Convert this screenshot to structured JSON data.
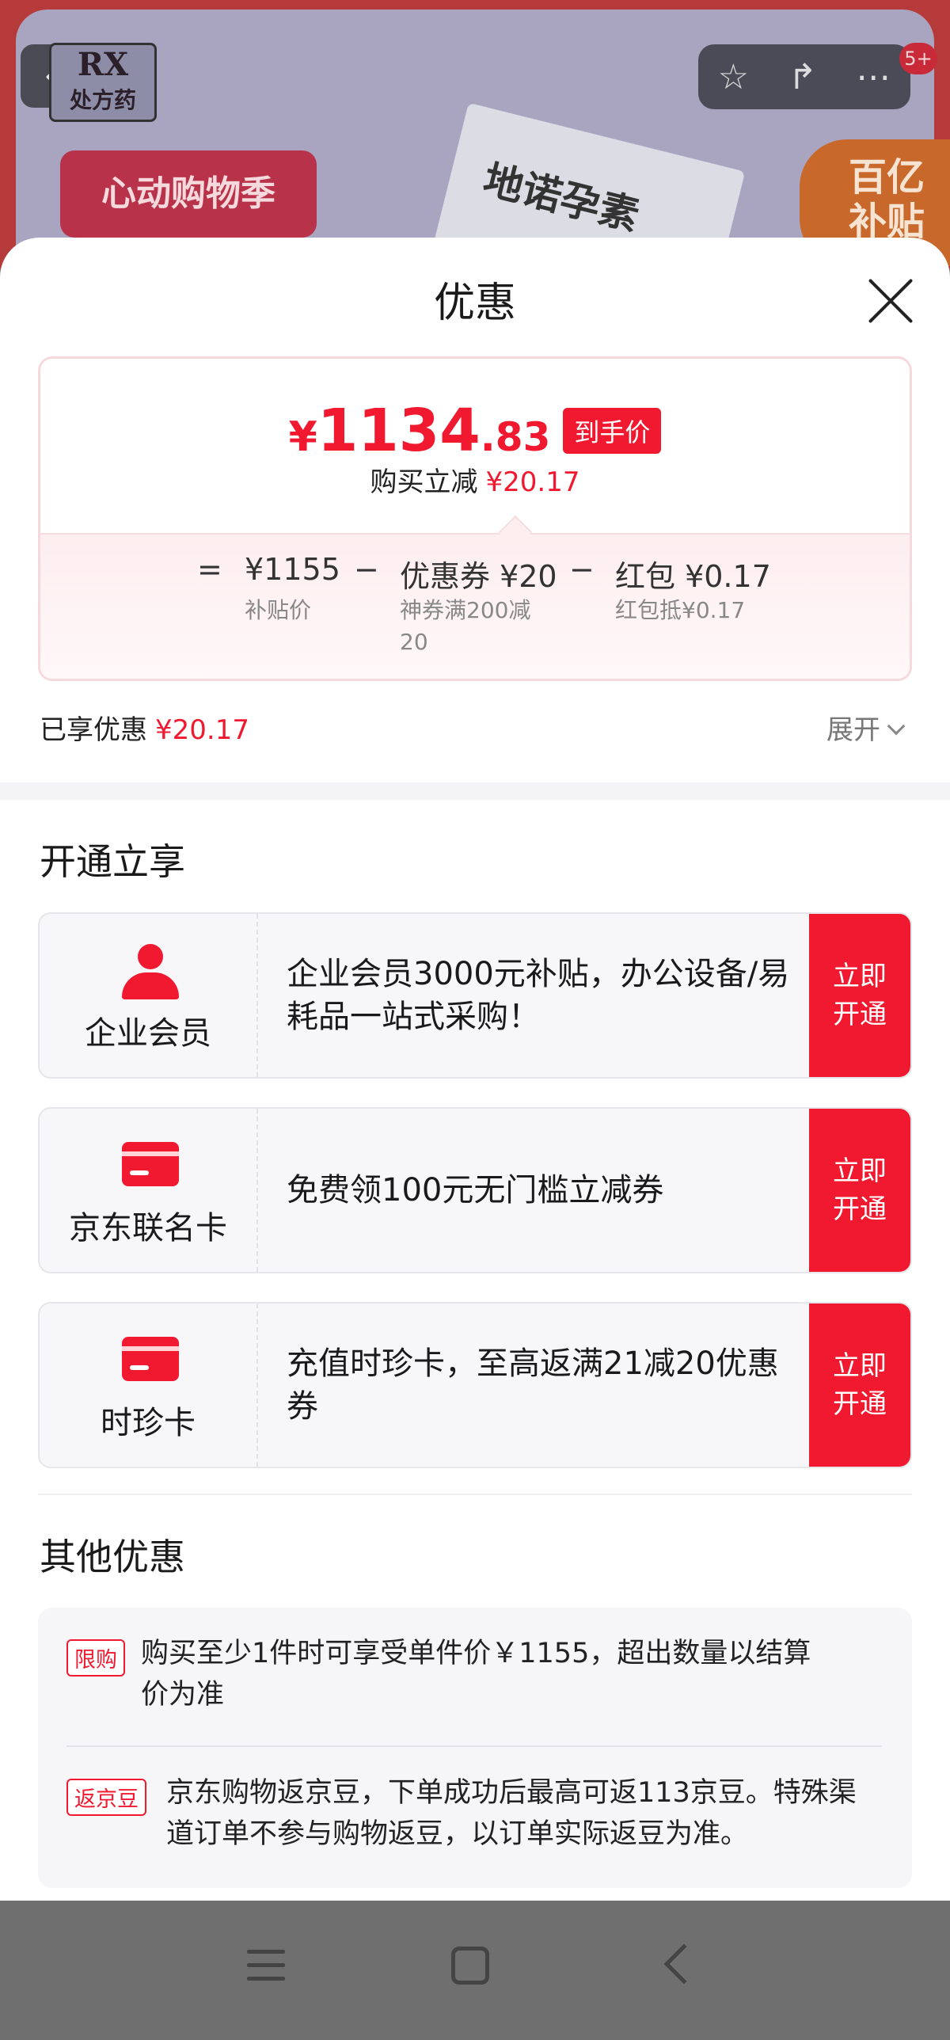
{
  "background": {
    "rx_label": "RX",
    "rx_sub": "处方药",
    "banner": "心动购物季",
    "product_text": "地诺孕素",
    "subsidy": [
      "百亿",
      "补贴"
    ],
    "badge": "5+"
  },
  "sheet": {
    "title": "优惠"
  },
  "price_card": {
    "currency": "¥",
    "price_int": "1134",
    "price_dec": ".83",
    "price_tag": "到手价",
    "sub_label": "购买立减",
    "sub_amount": "¥20.17",
    "formula": {
      "equals": "=",
      "base_value": "¥1155",
      "base_label": "补贴价",
      "minus1": "−",
      "coupon_value": "优惠券 ¥20",
      "coupon_label_line1": "神券满200减",
      "coupon_label_line2": "20",
      "minus2": "−",
      "redpacket_value": "红包 ¥0.17",
      "redpacket_label": "红包抵¥0.17"
    }
  },
  "enjoyed": {
    "label": "已享优惠",
    "amount": "¥20.17",
    "expand": "展开"
  },
  "open_section": {
    "title": "开通立享",
    "cards": [
      {
        "name": "企业会员",
        "icon": "person-icon",
        "desc": "企业会员3000元补贴，办公设备/易耗品一站式采购！",
        "button": "立即开通"
      },
      {
        "name": "京东联名卡",
        "icon": "card-icon",
        "desc": "免费领100元无门槛立减券",
        "button": "立即开通"
      },
      {
        "name": "时珍卡",
        "icon": "card-icon",
        "desc": "充值时珍卡，至高返满21减20优惠券",
        "button": "立即开通"
      }
    ]
  },
  "other_section": {
    "title": "其他优惠",
    "offers": [
      {
        "tag": "限购",
        "text": "购买至少1件时可享受单件价￥1155，超出数量以结算价为准"
      },
      {
        "tag": "返京豆",
        "text": "京东购物返京豆，下单成功后最高可返113京豆。特殊渠道订单不参与购物返豆，以订单实际返豆为准。"
      }
    ]
  },
  "colors": {
    "accent": "#f0192f",
    "card_bg": "#f7f7f9",
    "overlay": "#6f6f6f"
  }
}
